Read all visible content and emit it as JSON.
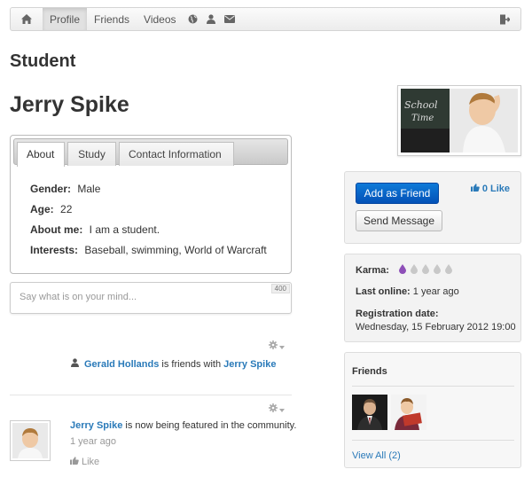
{
  "nav": {
    "items": [
      {
        "icon": "home-icon"
      },
      {
        "label": "Profile",
        "active": true
      },
      {
        "label": "Friends"
      },
      {
        "label": "Videos"
      },
      {
        "icon": "globe-icon"
      },
      {
        "icon": "user-icon"
      },
      {
        "icon": "envelope-icon"
      },
      {
        "icon": "logout-icon"
      }
    ]
  },
  "page": {
    "heading": "Student",
    "name": "Jerry Spike"
  },
  "tabs": [
    "About",
    "Study",
    "Contact Information"
  ],
  "about": {
    "gender_label": "Gender:",
    "gender": "Male",
    "age_label": "Age:",
    "age": "22",
    "aboutme_label": "About me:",
    "aboutme": "I am a student.",
    "interests_label": "Interests:",
    "interests": "Baseball, swimming, World of Warcraft"
  },
  "status": {
    "placeholder": "Say what is on your mind...",
    "char_limit": "400"
  },
  "feed": [
    {
      "actor": "Gerald Hollands",
      "verb": "is friends with",
      "target": "Jerry Spike"
    },
    {
      "actor": "Jerry Spike",
      "text": "is now being featured in the community.",
      "time": "1 year ago",
      "like": "Like"
    }
  ],
  "actions": {
    "add_friend": "Add as Friend",
    "send_message": "Send Message",
    "likes": "0 Like"
  },
  "stats": {
    "karma_label": "Karma:",
    "karma_level": 1,
    "karma_max": 5,
    "last_online_label": "Last online:",
    "last_online": "1 year ago",
    "registration_label": "Registration date:",
    "registration": "Wednesday, 15 February 2012 19:00"
  },
  "friends": {
    "title": "Friends",
    "view_all": "View All (2)"
  },
  "colors": {
    "accent": "#2a7ab9",
    "button_primary": "#0561c7",
    "karma_active": "#8e4fb8",
    "karma_inactive": "#c8c8c8"
  }
}
